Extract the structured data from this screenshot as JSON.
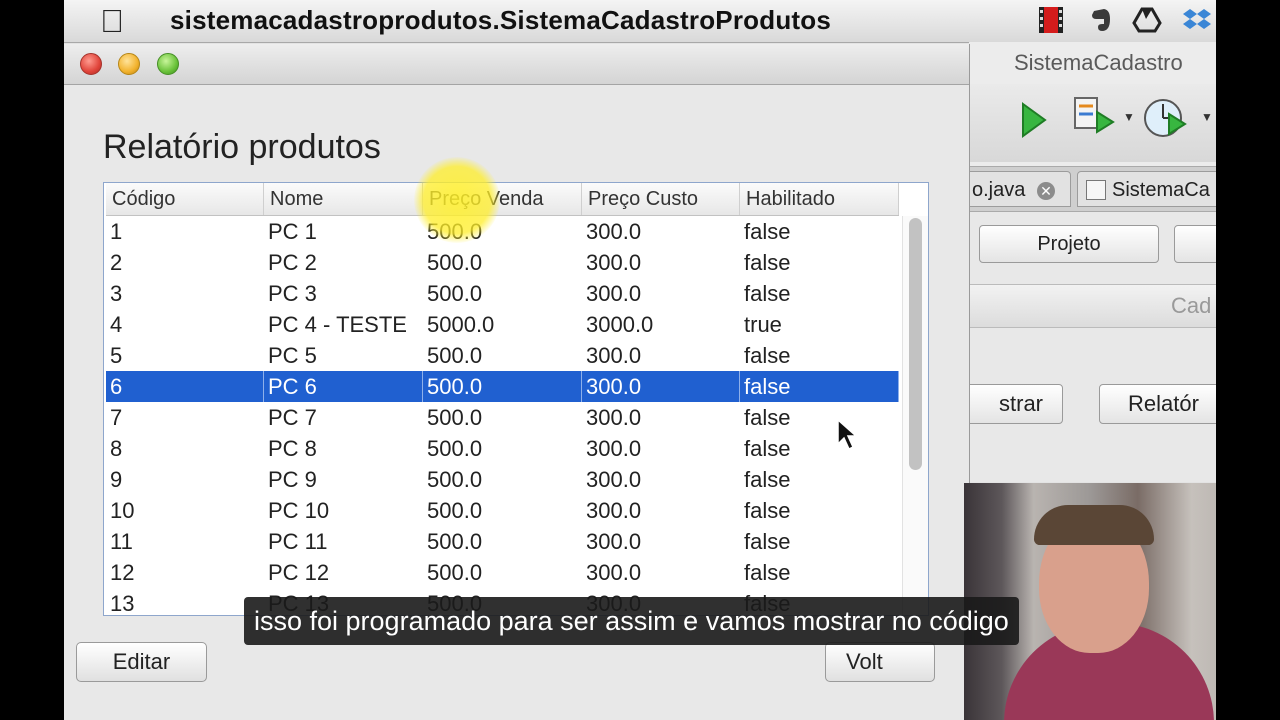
{
  "menubar": {
    "app_name": "sistemacadastroprodutos.SistemaCadastroProdutos"
  },
  "ide": {
    "title": "SistemaCadastro",
    "tabs": [
      {
        "label": "o.java"
      },
      {
        "label": "SistemaCa"
      }
    ],
    "buttons": {
      "projeto": "Projeto",
      "panel_title": "Cad",
      "mostrar": "strar",
      "relatorio": "Relatór"
    }
  },
  "dialog": {
    "heading": "Relatório produtos",
    "table": {
      "columns": [
        "Código",
        "Nome",
        "Preço Venda",
        "Preço Custo",
        "Habilitado"
      ],
      "rows": [
        [
          "1",
          "PC 1",
          "500.0",
          "300.0",
          "false"
        ],
        [
          "2",
          "PC 2",
          "500.0",
          "300.0",
          "false"
        ],
        [
          "3",
          "PC 3",
          "500.0",
          "300.0",
          "false"
        ],
        [
          "4",
          "PC 4 - TESTE",
          "5000.0",
          "3000.0",
          "true"
        ],
        [
          "5",
          "PC 5",
          "500.0",
          "300.0",
          "false"
        ],
        [
          "6",
          "PC 6",
          "500.0",
          "300.0",
          "false"
        ],
        [
          "7",
          "PC 7",
          "500.0",
          "300.0",
          "false"
        ],
        [
          "8",
          "PC 8",
          "500.0",
          "300.0",
          "false"
        ],
        [
          "9",
          "PC 9",
          "500.0",
          "300.0",
          "false"
        ],
        [
          "10",
          "PC 10",
          "500.0",
          "300.0",
          "false"
        ],
        [
          "11",
          "PC 11",
          "500.0",
          "300.0",
          "false"
        ],
        [
          "12",
          "PC 12",
          "500.0",
          "300.0",
          "false"
        ],
        [
          "13",
          "PC 13",
          "500.0",
          "300.0",
          "false"
        ]
      ],
      "selected_row": 5
    },
    "edit_label": "Editar",
    "back_label": "Volt"
  },
  "subtitle": "isso foi programado para ser assim e vamos mostrar no código",
  "colors": {
    "selection": "#2060d0",
    "table_border": "#8ea6cc"
  }
}
